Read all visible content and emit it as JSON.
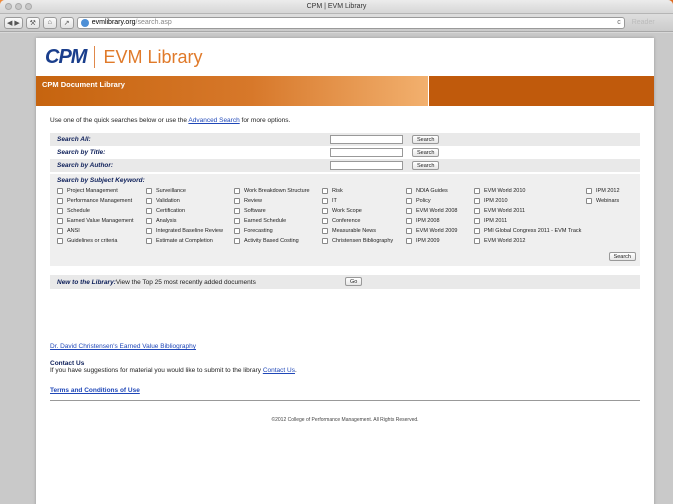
{
  "window": {
    "title": "CPM | EVM Library",
    "url_host": "evmlibrary.org",
    "url_path": "/search.asp",
    "reader_label": "Reader",
    "reload_icon": "c"
  },
  "logo": {
    "brand": "CPM",
    "name": "EVM Library"
  },
  "banner": {
    "title": "CPM Document Library"
  },
  "intro": {
    "before": "Use one of the quick searches below or use the ",
    "link": "Advanced Search",
    "after": " for more options."
  },
  "searches": [
    {
      "label": "Search All:",
      "button": "Search"
    },
    {
      "label": "Search by Title:",
      "button": "Search"
    },
    {
      "label": "Search by Author:",
      "button": "Search"
    }
  ],
  "keywords": {
    "title": "Search by Subject Keyword:",
    "button": "Search",
    "columns": [
      [
        "Project Management",
        "Performance Management",
        "Schedule",
        "Earned Value Management",
        "ANSI",
        "Guidelines or criteria"
      ],
      [
        "Surveillance",
        "Validation",
        "Certification",
        "Analysis",
        "Integrated Baseline Review",
        "Estimate at Completion"
      ],
      [
        "Work Breakdown Structure",
        "Review",
        "Software",
        "Earned Schedule",
        "Forecasting",
        "Activity Based Costing"
      ],
      [
        "Risk",
        "IT",
        "Work Scope",
        "Conference",
        "Measurable News",
        "Christensen Bibliography"
      ],
      [
        "NDIA Guides",
        "Policy",
        "EVM World 2008",
        "IPM 2008",
        "EVM World 2009",
        "IPM 2009"
      ],
      [
        "EVM World 2010",
        "IPM 2010",
        "EVM World 2011",
        "IPM 2011",
        "PMI Global Congress 2011 - EVM Track",
        "EVM World 2012"
      ],
      [
        "IPM 2012",
        "Webinars"
      ]
    ]
  },
  "new_library": {
    "label": "New to the Library:",
    "text": " View the Top 25 most recently added documents",
    "button": "Go"
  },
  "bibliography_link": "Dr. David Christensen's Earned Value Bibliography",
  "contact": {
    "heading": "Contact Us",
    "text": "If you have suggestions for material you would like to submit to the library ",
    "link": "Contact Us",
    "after": "."
  },
  "terms_link": "Terms and Conditions of Use",
  "footer": "©2012 College of Performance Management. All Rights Reserved."
}
